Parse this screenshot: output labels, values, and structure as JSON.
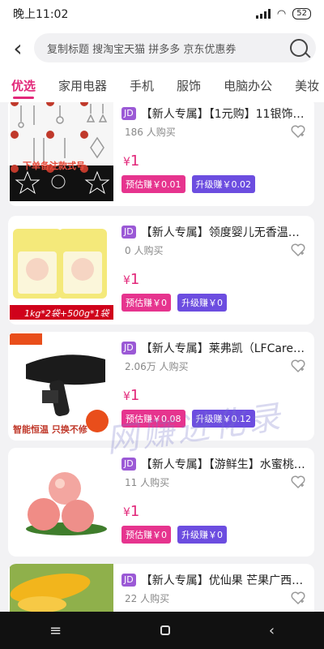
{
  "status": {
    "time": "晚上11:02",
    "battery": "52"
  },
  "search": {
    "text": "复制标题 搜淘宝天猫 拼多多 京东优惠券"
  },
  "tabs": [
    {
      "label": "优选"
    },
    {
      "label": "家用电器"
    },
    {
      "label": "手机"
    },
    {
      "label": "服饰"
    },
    {
      "label": "电脑办公"
    },
    {
      "label": "美妆"
    }
  ],
  "products": [
    {
      "badge": "JD",
      "title": "【新人专属】【1元购】11银饰…",
      "buyers": "186 人购买",
      "price_symbol": "¥",
      "price": "1",
      "est": "预估赚￥0.01",
      "upgrade": "升级赚￥0.02",
      "thumb_text": "下单备注款式号"
    },
    {
      "badge": "JD",
      "title": "【新人专属】领度婴儿无香温…",
      "buyers": "0 人购买",
      "price_symbol": "¥",
      "price": "1",
      "est": "预估赚￥0",
      "upgrade": "升级赚￥0",
      "thumb_text": "1kg*2袋+500g*1袋"
    },
    {
      "badge": "JD",
      "title": "【新人专属】莱弗凯（LFCare）…",
      "buyers": "2.06万 人购买",
      "price_symbol": "¥",
      "price": "1",
      "est": "预估赚￥0.08",
      "upgrade": "升级赚￥0.12",
      "thumb_text": "智能恒温 只换不修"
    },
    {
      "badge": "JD",
      "title": "【新人专属】【游鲜生】水蜜桃…",
      "buyers": "11 人购买",
      "price_symbol": "¥",
      "price": "1",
      "est": "预估赚￥0",
      "upgrade": "升级赚￥0",
      "thumb_text": ""
    },
    {
      "badge": "JD",
      "title": "【新人专属】优仙果 芒果广西…",
      "buyers": "22 人购买",
      "price_symbol": "¥",
      "price": "",
      "est": "",
      "upgrade": "",
      "thumb_text": ""
    }
  ],
  "watermark": "网赚进化录",
  "navbar": {
    "menu": "≡",
    "back": "‹"
  }
}
